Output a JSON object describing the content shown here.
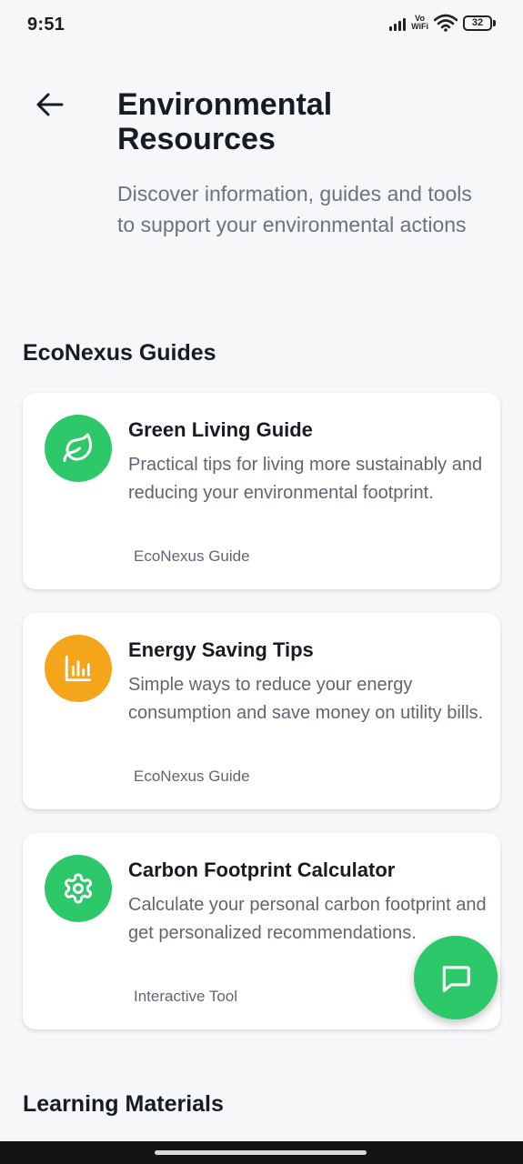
{
  "status_bar": {
    "time": "9:51",
    "network_label_top": "Vo",
    "network_label_bottom": "WiFi",
    "battery": "32"
  },
  "header": {
    "title": "Environmental Resources",
    "subtitle": "Discover information, guides and tools to support your environmental actions"
  },
  "sections": [
    {
      "heading": "EcoNexus Guides",
      "cards": [
        {
          "title": "Green Living Guide",
          "description": "Practical tips for living more sustainably and reducing your environmental footprint.",
          "tag": "EcoNexus Guide",
          "icon": "leaf-icon",
          "icon_color": "#2dc86a"
        },
        {
          "title": "Energy Saving Tips",
          "description": "Simple ways to reduce your energy consumption and save money on utility bills.",
          "tag": "EcoNexus Guide",
          "icon": "bar-chart-icon",
          "icon_color": "#f5a519"
        },
        {
          "title": "Carbon Footprint Calculator",
          "description": "Calculate your personal carbon footprint and get personalized recommendations.",
          "tag": "Interactive Tool",
          "icon": "gear-icon",
          "icon_color": "#2dc86a"
        }
      ]
    },
    {
      "heading": "Learning Materials"
    }
  ],
  "fab": {
    "icon": "chat-icon",
    "color": "#2dc86a"
  },
  "colors": {
    "background": "#f6f7f9",
    "green": "#2dc86a",
    "orange": "#f5a519"
  }
}
